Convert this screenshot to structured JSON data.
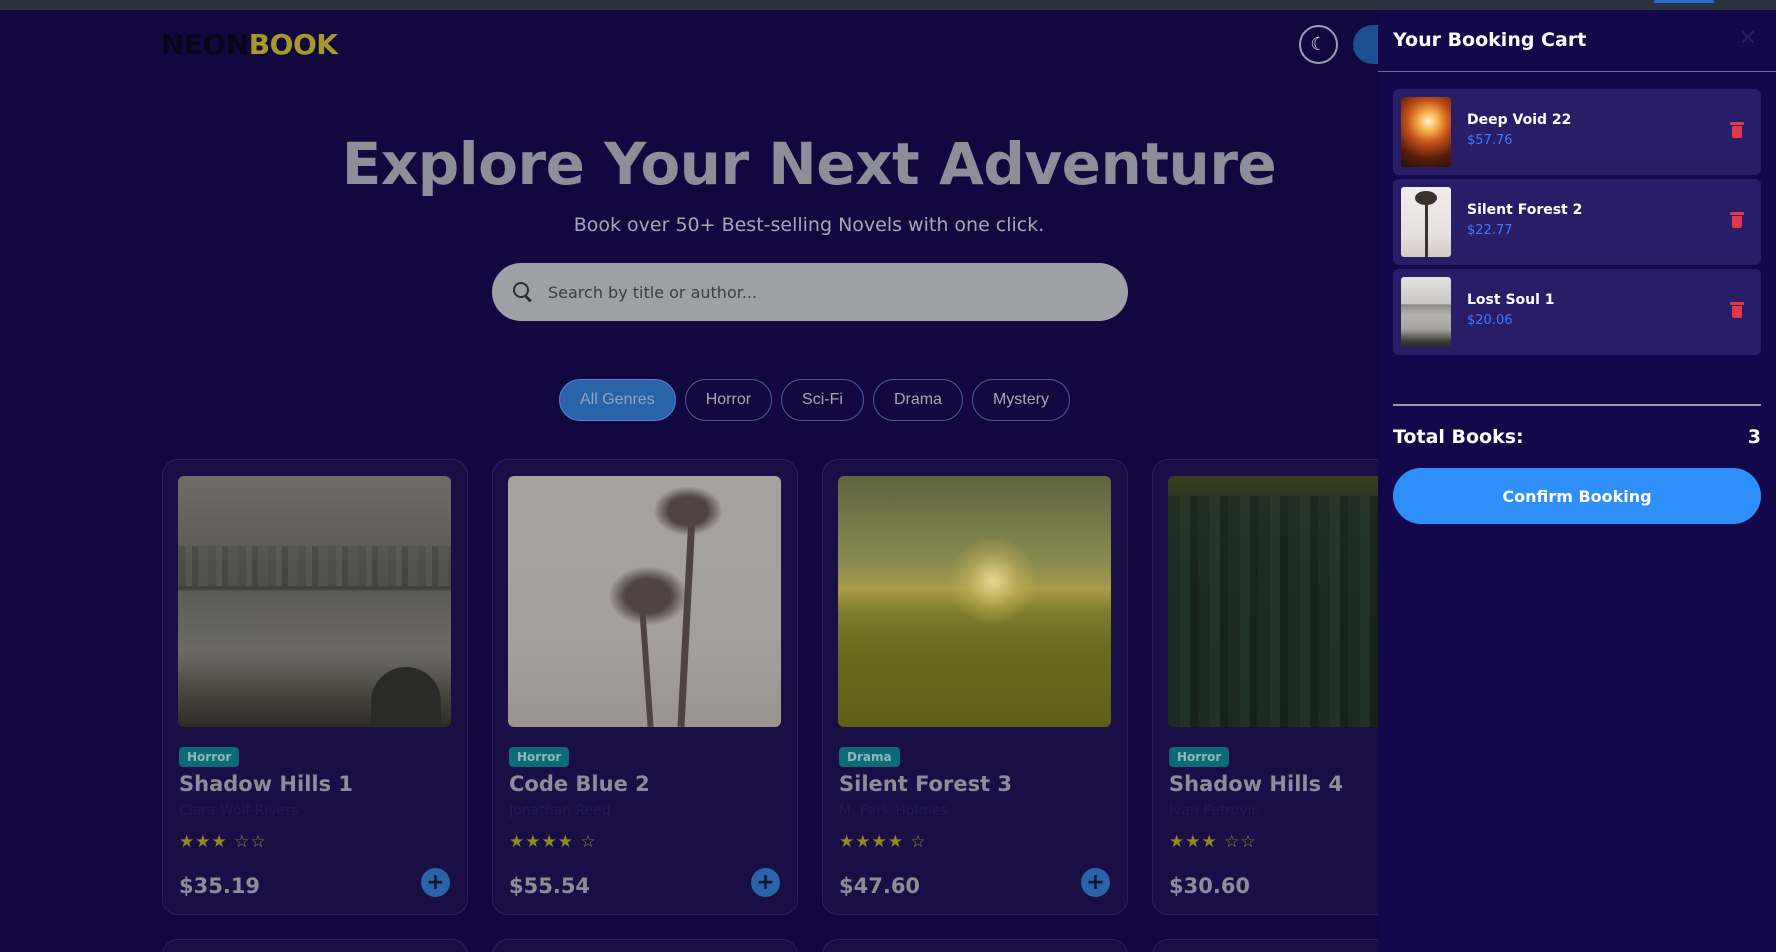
{
  "brand": {
    "part1": "NEON",
    "part2": "BOOK"
  },
  "header": {
    "theme_icon": "moon-icon"
  },
  "hero": {
    "title": "Explore Your Next Adventure",
    "subtitle": "Book over 50+ Best-selling Novels with one click."
  },
  "search": {
    "placeholder": "Search by title or author...",
    "icon": "search-icon"
  },
  "genres": [
    "All Genres",
    "Horror",
    "Sci-Fi",
    "Drama",
    "Mystery"
  ],
  "books": [
    {
      "genre": "Horror",
      "title": "Shadow Hills 1",
      "author": "Clara Wolf-Rivers",
      "rating": 3,
      "price": "$35.19"
    },
    {
      "genre": "Horror",
      "title": "Code Blue 2",
      "author": "Jonathan Reed",
      "rating": 4,
      "price": "$55.54"
    },
    {
      "genre": "Drama",
      "title": "Silent Forest 3",
      "author": "M. Park-Holmes",
      "rating": 4,
      "price": "$47.60"
    },
    {
      "genre": "Horror",
      "title": "Shadow Hills 4",
      "author": "Ivan Petrovic",
      "rating": 3,
      "price": "$30.60"
    }
  ],
  "cart": {
    "title": "Your Booking Cart",
    "close_icon": "close-icon",
    "items": [
      {
        "name": "Deep Void 22",
        "price": "$57.76"
      },
      {
        "name": "Silent Forest 2",
        "price": "$22.77"
      },
      {
        "name": "Lost Soul 1",
        "price": "$20.06"
      }
    ],
    "total_label": "Total Books:",
    "total_value": "3",
    "confirm_label": "Confirm Booking"
  },
  "colors": {
    "accent": "#2e8ffb",
    "background": "#12083f",
    "danger": "#e0394a",
    "price_blue": "#3d7bff"
  }
}
